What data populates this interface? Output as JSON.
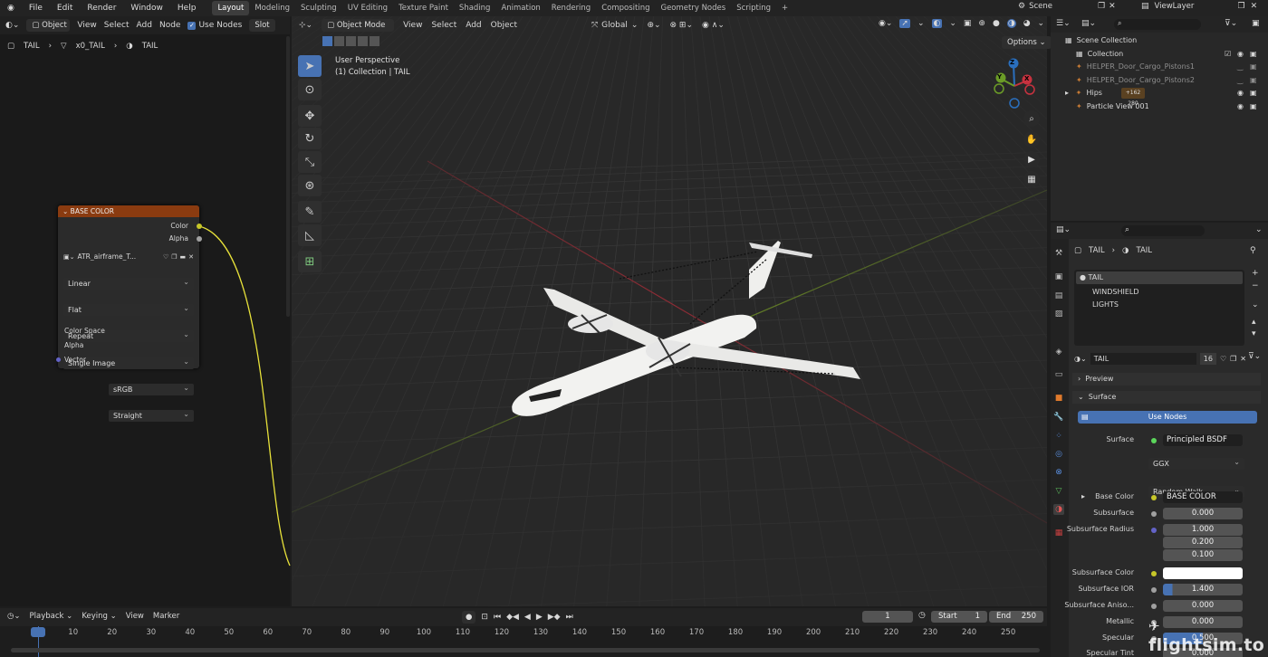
{
  "menu": [
    "File",
    "Edit",
    "Render",
    "Window",
    "Help"
  ],
  "workspaces": [
    "Layout",
    "Modeling",
    "Sculpting",
    "UV Editing",
    "Texture Paint",
    "Shading",
    "Animation",
    "Rendering",
    "Compositing",
    "Geometry Nodes",
    "Scripting"
  ],
  "scene": "Scene",
  "view_layer": "ViewLayer",
  "node_header": {
    "object": "Object",
    "view": "View",
    "select": "Select",
    "add": "Add",
    "node": "Node",
    "use_nodes": "Use Nodes",
    "slot": "Slot"
  },
  "breadcrumb": [
    "TAIL",
    "x0_TAIL",
    "TAIL"
  ],
  "node": {
    "title": "BASE COLOR",
    "out_color": "Color",
    "out_alpha": "Alpha",
    "image": "ATR_airframe_T...",
    "interp": "Linear",
    "proj": "Flat",
    "ext": "Repeat",
    "source": "Single Image",
    "cs_label": "Color Space",
    "cs": "sRGB",
    "alpha_label": "Alpha",
    "alpha": "Straight",
    "vector": "Vector"
  },
  "viewport": {
    "mode": "Object Mode",
    "view": "View",
    "select": "Select",
    "add": "Add",
    "object": "Object",
    "orient": "Global",
    "options": "Options",
    "persp": "User Perspective",
    "coll": "(1) Collection | TAIL",
    "gx": "X",
    "gy": "Y",
    "gz": "Z"
  },
  "outliner": {
    "root": "Scene Collection",
    "coll": "Collection",
    "items": [
      "HELPER_Door_Cargo_Pistons1",
      "HELPER_Door_Cargo_Pistons2",
      "Hips",
      "Particle View 001"
    ],
    "hips_badge": "+162 280"
  },
  "props": {
    "crumb1": "TAIL",
    "crumb2": "TAIL",
    "slots": [
      "TAIL",
      "WINDSHIELD",
      "LIGHTS"
    ],
    "mat": "TAIL",
    "users": "16",
    "preview": "Preview",
    "surface_hdr": "Surface",
    "use_nodes": "Use Nodes",
    "surface_label": "Surface",
    "surface_val": "Principled BSDF",
    "dist": "GGX",
    "sss_method": "Random Walk",
    "base_color_label": "Base Color",
    "base_color_val": "BASE COLOR",
    "subsurface_label": "Subsurface",
    "subsurface_val": "0.000",
    "radius_label": "Subsurface Radius",
    "radius": [
      "1.000",
      "0.200",
      "0.100"
    ],
    "sss_color_label": "Subsurface Color",
    "ior_label": "Subsurface IOR",
    "ior_val": "1.400",
    "aniso_label": "Subsurface Aniso...",
    "aniso_val": "0.000",
    "metallic_label": "Metallic",
    "metallic_val": "0.000",
    "specular_label": "Specular",
    "specular_val": "0.500",
    "spectint_label": "Specular Tint",
    "spectint_val": "0.000"
  },
  "timeline": {
    "playback": "Playback",
    "keying": "Keying",
    "view": "View",
    "marker": "Marker",
    "frame": "1",
    "start_label": "Start",
    "start": "1",
    "end_label": "End",
    "end": "250",
    "ticks": [
      "1",
      "10",
      "20",
      "30",
      "40",
      "50",
      "60",
      "70",
      "80",
      "90",
      "100",
      "110",
      "120",
      "130",
      "140",
      "150",
      "160",
      "170",
      "180",
      "190",
      "200",
      "210",
      "220",
      "230",
      "240",
      "250"
    ]
  },
  "watermark": "flightsim.to",
  "colors": {
    "accent": "#4772b3",
    "node_header": "#8a3b10",
    "link": "#e7e13a"
  }
}
